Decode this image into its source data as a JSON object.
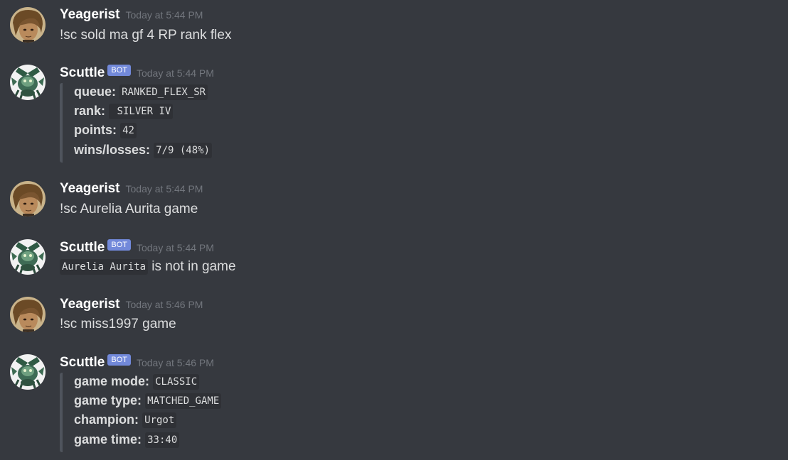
{
  "colors": {
    "background": "#36393f",
    "username": "#ffffff",
    "text": "#dcddde",
    "timestamp": "#72767d",
    "bot_tag": "#7289da",
    "code_background": "#2f3136",
    "embed_border": "#4f545c"
  },
  "bot_tag": "BOT",
  "messages": [
    {
      "author": "Yeagerist",
      "timestamp": "Today at 5:44 PM",
      "text": "!sc sold ma gf 4 RP rank flex",
      "avatar": "yeagerist-avatar"
    },
    {
      "author": "Scuttle",
      "timestamp": "Today at 5:44 PM",
      "avatar": "scuttle-avatar",
      "embed": {
        "fields": [
          {
            "name": "queue:",
            "value": "RANKED_FLEX_SR"
          },
          {
            "name": "rank:",
            "value": " SILVER IV"
          },
          {
            "name": "points:",
            "value": "42"
          },
          {
            "name": "wins/losses:",
            "value": "7/9 (48%)"
          }
        ]
      }
    },
    {
      "author": "Yeagerist",
      "timestamp": "Today at 5:44 PM",
      "text": "!sc Aurelia Aurita game",
      "avatar": "yeagerist-avatar"
    },
    {
      "author": "Scuttle",
      "timestamp": "Today at 5:44 PM",
      "avatar": "scuttle-avatar",
      "code": "Aurelia Aurita",
      "text": " is not in game"
    },
    {
      "author": "Yeagerist",
      "timestamp": "Today at 5:46 PM",
      "text": "!sc miss1997 game",
      "avatar": "yeagerist-avatar"
    },
    {
      "author": "Scuttle",
      "timestamp": "Today at 5:46 PM",
      "avatar": "scuttle-avatar",
      "embed": {
        "fields": [
          {
            "name": "game mode:",
            "value": "CLASSIC"
          },
          {
            "name": "game type:",
            "value": "MATCHED_GAME"
          },
          {
            "name": "champion:",
            "value": "Urgot"
          },
          {
            "name": "game time:",
            "value": "33:40"
          }
        ]
      }
    }
  ]
}
